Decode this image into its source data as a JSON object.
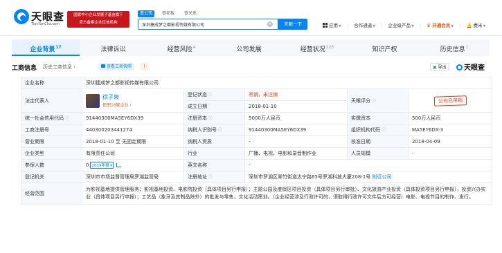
{
  "header": {
    "logo_cn": "天眼查",
    "logo_en": "TianYanCha.com",
    "banner_line1": "国家中小企业发展子基金旗下",
    "banner_line2": "官方备案企业征信机构",
    "search_tabs": [
      "查公司",
      "查老板",
      "查关系"
    ],
    "search_value": "深圳捷成梦之都影视传媒有限公司",
    "search_clear": "×",
    "search_button": "天眼一下",
    "nav": {
      "apps": "应用",
      "partner": "合作通道",
      "products": "企业级产品",
      "vip": "开通会员",
      "user": "费米"
    }
  },
  "tabs": [
    {
      "label": "企业背景",
      "count": "17"
    },
    {
      "label": "法律诉讼",
      "count": ""
    },
    {
      "label": "经营风险",
      "count": "4"
    },
    {
      "label": "公司发展",
      "count": ""
    },
    {
      "label": "经营状况",
      "count": "225"
    },
    {
      "label": "知识产权",
      "count": ""
    },
    {
      "label": "历史信息",
      "count": "1"
    }
  ],
  "section": {
    "title": "工商信息",
    "history_link": "历史工商信息 ›",
    "view_btn": "查看工商快照",
    "warn": "!",
    "export": "导出",
    "brand": "天眼查"
  },
  "info": {
    "company_name_label": "企业名称",
    "company_name": "深圳捷成梦之都影视传媒有限公司",
    "rep_label": "法定代表人",
    "rep_name": "徐子泉",
    "rep_sub": "任职16家企业 ›",
    "status_label": "登记状态",
    "status_value": "吊销，未注销",
    "established_label": "成立日期",
    "established_value": "2018-01-10",
    "score_label": "天眼评分",
    "score_stamp": "公司已吊销",
    "credit_code_label": "统一社会信用代码",
    "credit_code": "91440300MA5EY6DX39",
    "reg_capital_label": "注册资本",
    "reg_capital": "5000万人民币",
    "paid_capital_label": "实缴资本",
    "paid_capital": "500万人民币",
    "reg_no_label": "工商注册号",
    "reg_no": "440300203441274",
    "taxpayer_label": "纳税人识别号",
    "taxpayer_no": "91440300MA5EY6DX39",
    "org_code_label": "组织机构代码",
    "org_code": "MA5EY6DX-3",
    "term_label": "营业期限",
    "term_value": "2018-01-10 至 无固定期限",
    "taxpayer_qual_label": "纳税人资质",
    "taxpayer_qual": "-",
    "approve_date_label": "核准日期",
    "approve_date": "2018-04-09",
    "type_label": "企业类型",
    "type_value": "有限责任公司",
    "industry_label": "行业",
    "industry_value": "广播、电视、电影和录音制作业",
    "staff_label": "人员规模",
    "staff_value": "-",
    "insured_label": "参保人数",
    "insured_value": "0",
    "insured_year": "2019年报",
    "english_label": "英文名称",
    "english_value": "-",
    "authority_label": "登记机关",
    "authority_value": "深圳市市场监督管理局罗湖监管局",
    "address_label": "注册地址",
    "address_value": "深圳市罗湖区翠竹街道太宁路65号罗湖科技大厦208-1号",
    "nearby": "附近公司",
    "scope_label": "经营范围",
    "scope_value": "为影视基地提供管理服务；影视基地投资、电影院投资（具体项目另行申报）；主题公园及度假区项目投资（具体项目另行审批）、文化旅游产业投资（具体投资项目另行申报），投资兴办实业（具体项目另行申报）；工艺品（象牙及其制品除外）的批发与零售，文化活动策划。（企业经营涉及行政许可的，须取得行政许可文件后方可经营）电影、电视节目的制作、发行。"
  },
  "colors": {
    "brand_blue": "#0084ff",
    "banner_red": "#c8161d",
    "status_red": "#e8340c",
    "vip_orange": "#e8590c"
  }
}
